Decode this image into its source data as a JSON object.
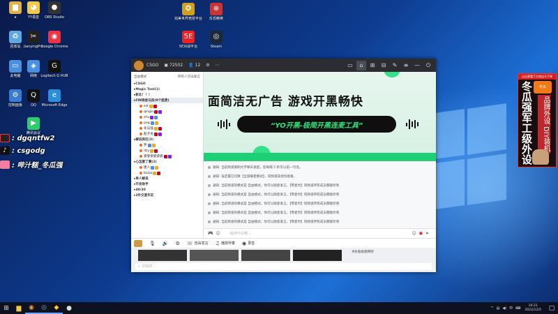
{
  "desktop": {
    "icons": [
      {
        "label": "a",
        "name": "desktop-icon-a"
      },
      {
        "label": "YY语音",
        "name": "desktop-icon-yy"
      },
      {
        "label": "OBS Studio",
        "name": "desktop-icon-obs"
      },
      {
        "label": "回收站",
        "name": "desktop-icon-recycle"
      },
      {
        "label": "JianyingPro",
        "name": "desktop-icon-jianying"
      },
      {
        "label": "Google Chrome",
        "name": "desktop-icon-chrome"
      },
      {
        "label": "此电脑",
        "name": "desktop-icon-pc"
      },
      {
        "label": "网络",
        "name": "desktop-icon-network"
      },
      {
        "label": "Logitech G HUB",
        "name": "desktop-icon-ghub"
      },
      {
        "label": "控制面板",
        "name": "desktop-icon-control"
      },
      {
        "label": "QQ",
        "name": "desktop-icon-qq"
      },
      {
        "label": "Microsoft Edge",
        "name": "desktop-icon-edge"
      },
      {
        "label": "腾讯会议",
        "name": "desktop-icon-meeting"
      },
      {
        "label": "完美世界竞技平台",
        "name": "desktop-icon-perfect"
      },
      {
        "label": "反恐精英",
        "name": "desktop-icon-csgo"
      },
      {
        "label": "5E对战平台",
        "name": "desktop-icon-5e"
      },
      {
        "label": "Steam",
        "name": "desktop-icon-steam"
      }
    ],
    "overlay": {
      "line1": ": dgqntfw2",
      "line2": ": csgodg",
      "line3": ": 哔汁糕_冬瓜强"
    },
    "promo": {
      "top": "点击观看下方商店卡下单",
      "big": "冬瓜强军工级外设",
      "side": "品牌外设 DIY装机",
      "logo": "冬瓜"
    }
  },
  "app": {
    "title": "CSGO",
    "room_id": "72502",
    "online": "12",
    "sidebar": {
      "mode": "自由模式",
      "search_hint": "所有人可以发言",
      "rows": [
        {
          "text": "CSGO",
          "type": "channel"
        },
        {
          "text": "Magic Tool(1)",
          "type": "channel"
        },
        {
          "text": "新北！！！",
          "type": "channel"
        },
        {
          "text": "FIN场金马良(9个座麦)",
          "type": "channel",
          "selected": true
        },
        {
          "text": "sld",
          "type": "user"
        },
        {
          "text": "qingin",
          "type": "user"
        },
        {
          "text": "shu",
          "type": "user"
        },
        {
          "text": "peg",
          "type": "user"
        },
        {
          "text": "冬瓜强",
          "type": "user"
        },
        {
          "text": "赵子龙",
          "type": "user"
        },
        {
          "text": "解说房区(3)",
          "type": "channel"
        },
        {
          "text": "罗",
          "type": "user"
        },
        {
          "text": "dzy",
          "type": "user"
        },
        {
          "text": "姿姿姿姿姿姿",
          "type": "user"
        },
        {
          "text": "心怎麼了看(2)",
          "type": "channel"
        },
        {
          "text": "唐人",
          "type": "user"
        },
        {
          "text": "baiza",
          "type": "user"
        },
        {
          "text": "单人解说",
          "type": "channel"
        },
        {
          "text": "开发助手",
          "type": "channel"
        },
        {
          "text": "49/30",
          "type": "channel"
        },
        {
          "text": "3外交复年区",
          "type": "channel"
        }
      ]
    },
    "banner": {
      "headline": "面简洁无广告  游戏开黑畅快",
      "pill": "“YO开黑-极简开黑连麦工具”"
    },
    "messages": [
      "通知: 当前频道限制文字聊天速度，您每隔 5 秒可以说一句话。",
      "通知: 设定置已切换【全部联麦模式】，同频道其他均能看。",
      "通知: 当前频道的模式是 自由模式，你可以随意发言。【零麦时】同频道所有成员都能听到",
      "通知: 当前频道的模式是 自由模式，你可以随意发言。【零麦时】同频道所有成员都能听到",
      "通知: 当前频道的模式是 自由模式，你可以随意发言。【零麦时】同频道所有成员都能听到",
      "通知: 当前频道的模式是 自由模式，你可以随意发言。【零麦时】同频道所有成员都能听到",
      "通知: 当前频道的模式是 自由模式，你可以随意发言。【零麦时】同频道所有成员都能听到"
    ],
    "input_placeholder": "说点什么吧...",
    "toolbar": {
      "free": "自由发言",
      "broadcast": "播放伴奏",
      "record": "录音"
    },
    "bg_panel": {
      "player": "寻乐独角兽网吧",
      "search": "CSGO"
    }
  },
  "taskbar": {
    "time": "19:21",
    "date": "2022/12/5",
    "lang": "中"
  },
  "colors": {
    "banner_green": "#1dcf75",
    "pill_text": "#2ee37a",
    "titlebar": "#2b2d33"
  }
}
